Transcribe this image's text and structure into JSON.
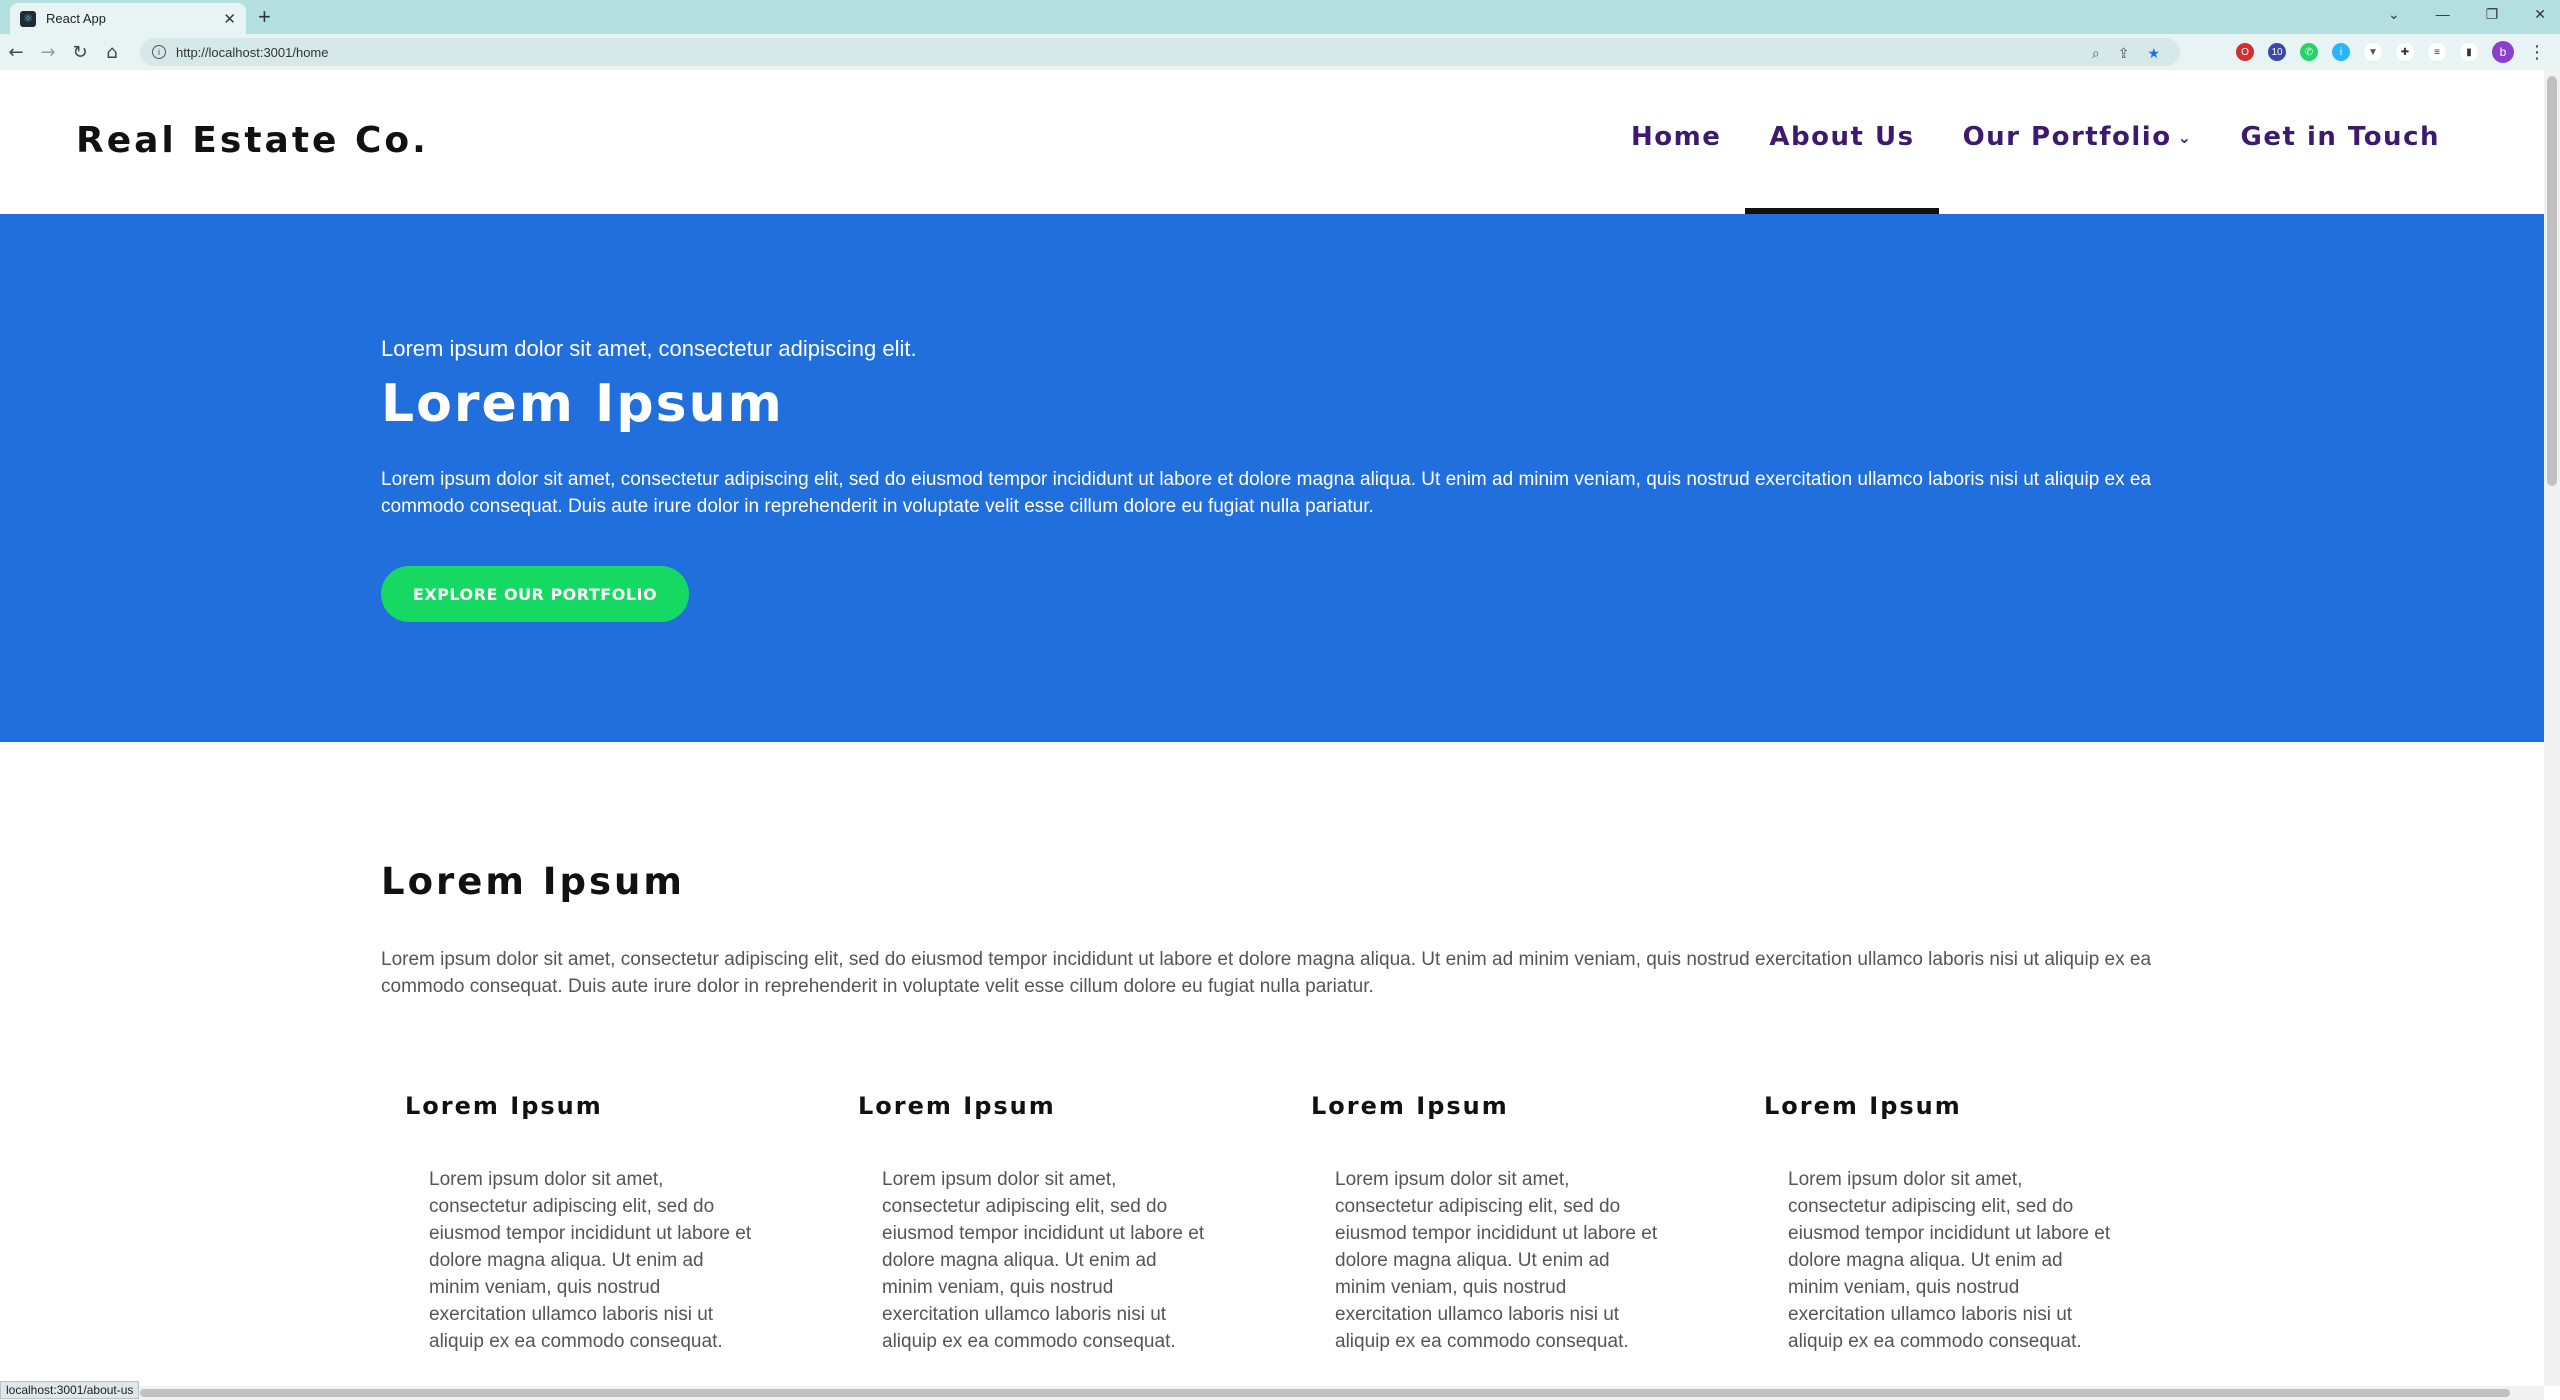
{
  "browser": {
    "tab_title": "React App",
    "tab_close": "✕",
    "new_tab": "+",
    "url": "http://localhost:3001/home",
    "status_url": "localhost:3001/about-us",
    "profile_initial": "b",
    "ext_badge": "10",
    "window_controls": [
      "⌄",
      "—",
      "❐",
      "✕"
    ]
  },
  "site": {
    "brand": "Real Estate Co.",
    "nav": [
      {
        "label": "Home"
      },
      {
        "label": "About Us",
        "active": true
      },
      {
        "label": "Our Portfolio",
        "has_dropdown": true
      },
      {
        "label": "Get in Touch"
      }
    ]
  },
  "hero": {
    "kicker": "Lorem ipsum dolor sit amet, consectetur adipiscing elit.",
    "title": "Lorem Ipsum",
    "body": "Lorem ipsum dolor sit amet, consectetur adipiscing elit, sed do eiusmod tempor incididunt ut labore et dolore magna aliqua. Ut enim ad minim veniam, quis nostrud exercitation ullamco laboris nisi ut aliquip ex ea commodo consequat. Duis aute irure dolor in reprehenderit in voluptate velit esse cillum dolore eu fugiat nulla pariatur.",
    "cta": "EXPLORE OUR PORTFOLIO",
    "bg_color": "#216fdc",
    "cta_color": "#16d964"
  },
  "section": {
    "title": "Lorem Ipsum",
    "body": "Lorem ipsum dolor sit amet, consectetur adipiscing elit, sed do eiusmod tempor incididunt ut labore et dolore magna aliqua. Ut enim ad minim veniam, quis nostrud exercitation ullamco laboris nisi ut aliquip ex ea commodo consequat. Duis aute irure dolor in reprehenderit in voluptate velit esse cillum dolore eu fugiat nulla pariatur.",
    "columns": [
      {
        "title": "Lorem Ipsum",
        "body": "Lorem ipsum dolor sit amet, consectetur adipiscing elit, sed do eiusmod tempor incididunt ut labore et dolore magna aliqua. Ut enim ad minim veniam, quis nostrud exercitation ullamco laboris nisi ut aliquip ex ea commodo consequat."
      },
      {
        "title": "Lorem Ipsum",
        "body": "Lorem ipsum dolor sit amet, consectetur adipiscing elit, sed do eiusmod tempor incididunt ut labore et dolore magna aliqua. Ut enim ad minim veniam, quis nostrud exercitation ullamco laboris nisi ut aliquip ex ea commodo consequat."
      },
      {
        "title": "Lorem Ipsum",
        "body": "Lorem ipsum dolor sit amet, consectetur adipiscing elit, sed do eiusmod tempor incididunt ut labore et dolore magna aliqua. Ut enim ad minim veniam, quis nostrud exercitation ullamco laboris nisi ut aliquip ex ea commodo consequat."
      },
      {
        "title": "Lorem Ipsum",
        "body": "Lorem ipsum dolor sit amet, consectetur adipiscing elit, sed do eiusmod tempor incididunt ut labore et dolore magna aliqua. Ut enim ad minim veniam, quis nostrud exercitation ullamco laboris nisi ut aliquip ex ea commodo consequat."
      }
    ]
  }
}
